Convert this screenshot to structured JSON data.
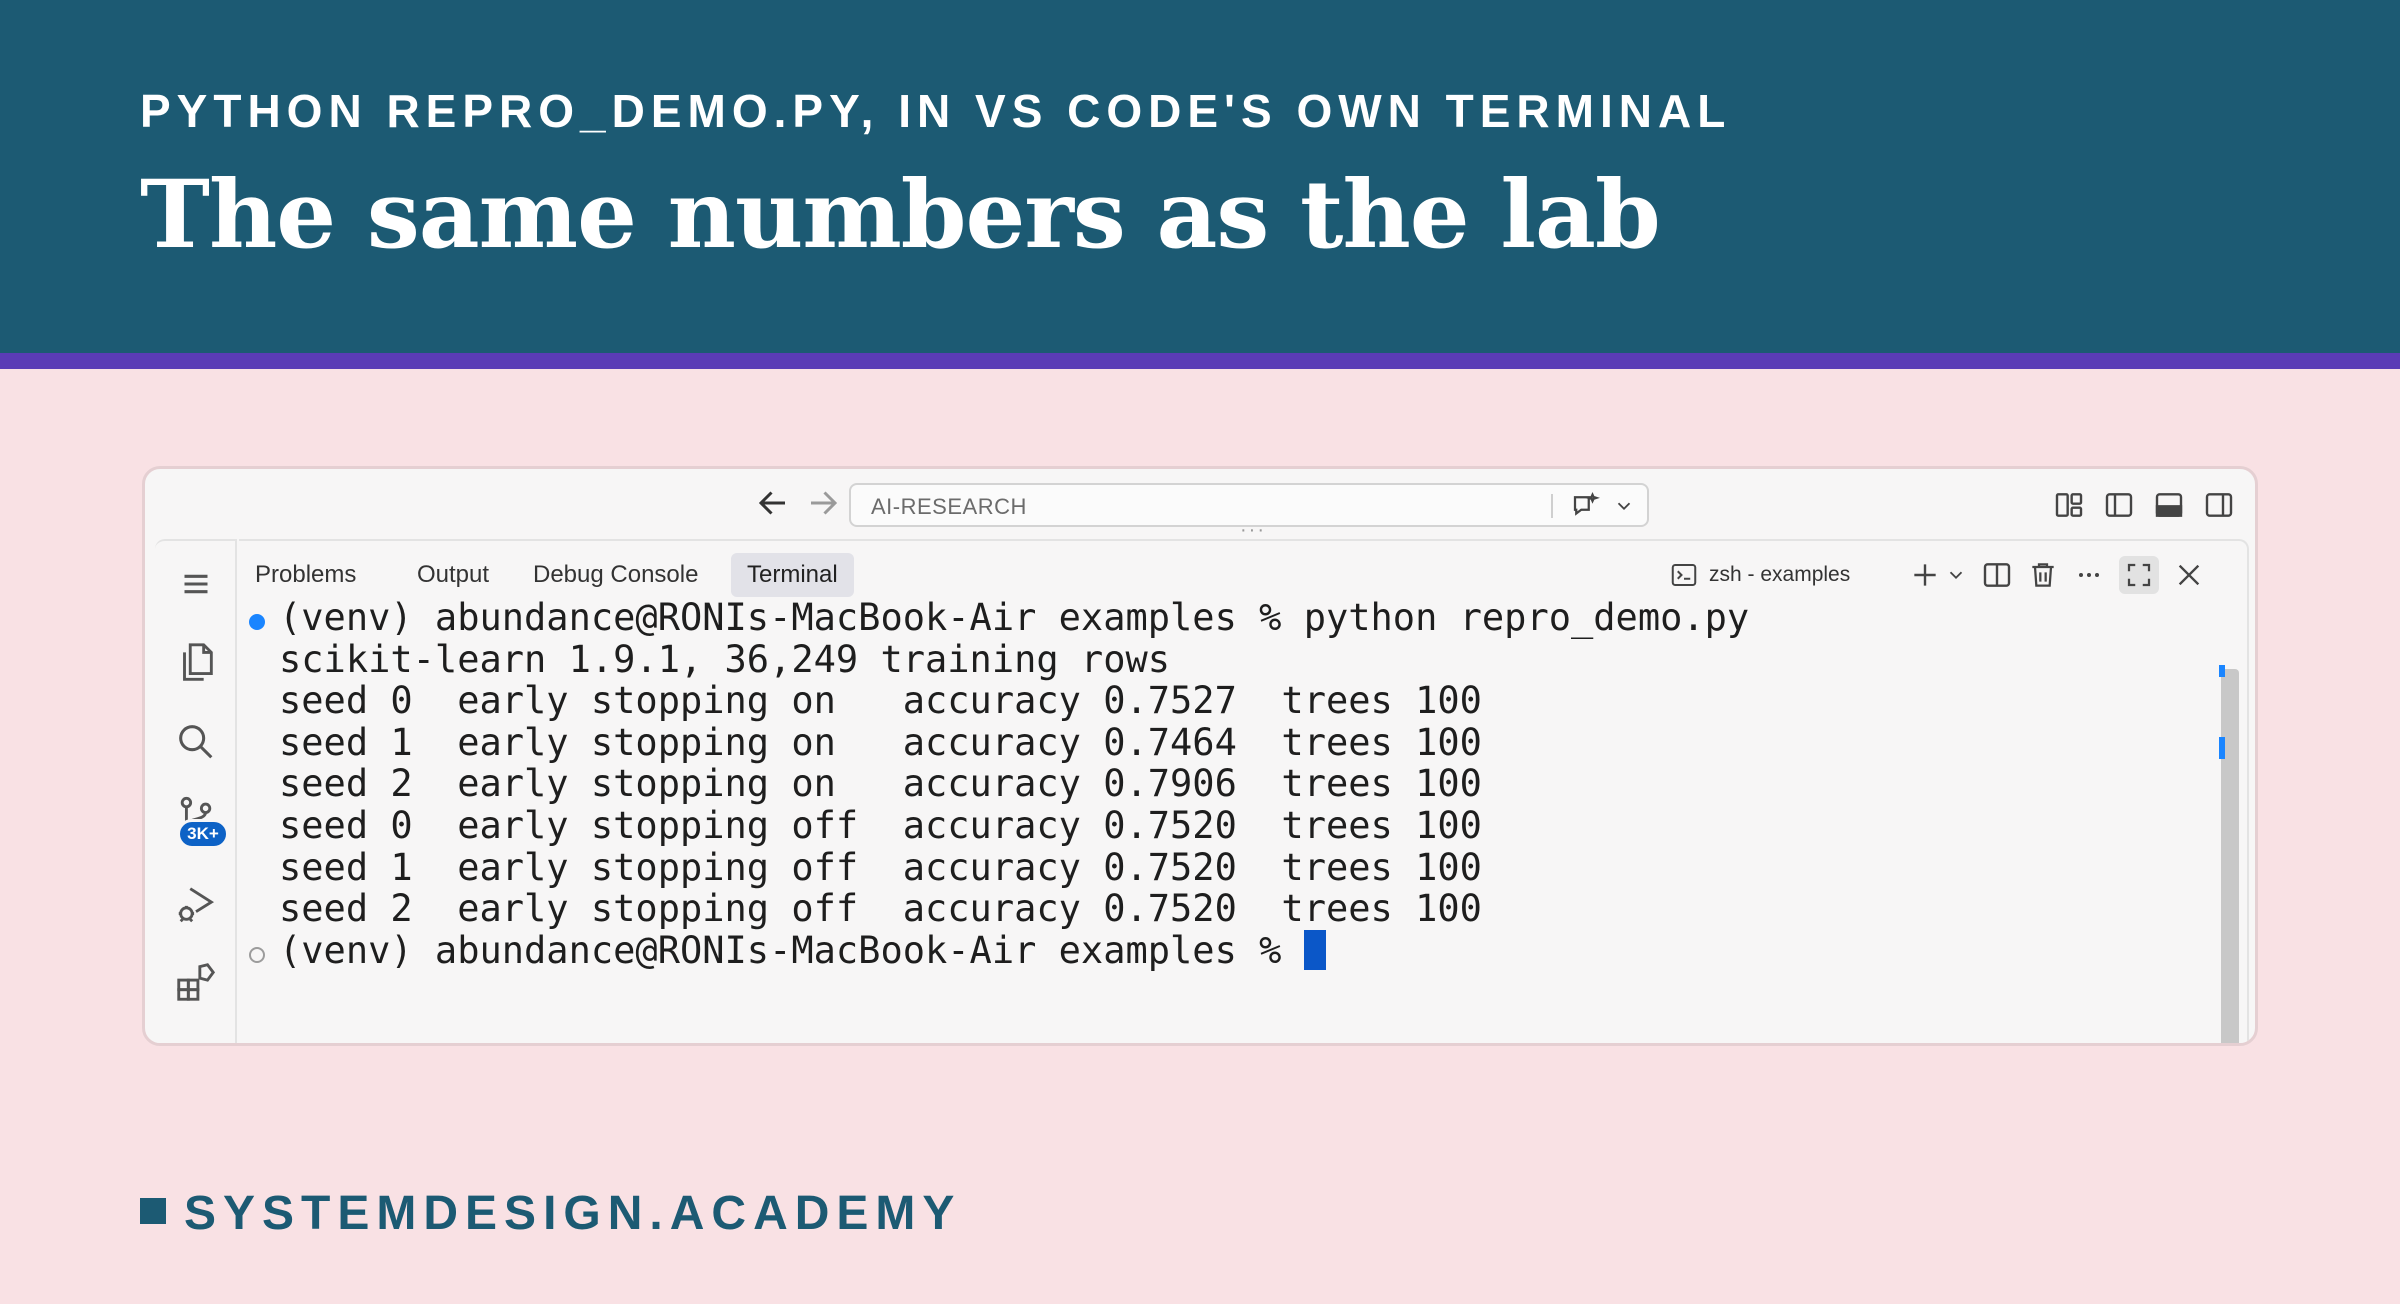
{
  "header": {
    "kicker": "PYTHON REPRO_DEMO.PY, IN VS CODE'S OWN TERMINAL",
    "title": "The same numbers as the lab"
  },
  "titlebar": {
    "command_center": "AI-RESEARCH",
    "icons": [
      "arrow-left-icon",
      "arrow-right-icon",
      "chat-sparkle-icon",
      "chevron-down-icon",
      "customize-layout-icon",
      "toggle-sidebar-icon",
      "toggle-panel-icon",
      "toggle-secondary-sidebar-icon"
    ]
  },
  "activity_bar": {
    "items": [
      "menu-icon",
      "explorer-icon",
      "search-icon",
      "source-control-icon",
      "run-debug-icon",
      "extensions-icon"
    ],
    "source_control_badge": "3K+"
  },
  "panel": {
    "tabs": [
      {
        "label": "Problems",
        "active": false
      },
      {
        "label": "Output",
        "active": false
      },
      {
        "label": "Debug Console",
        "active": false
      },
      {
        "label": "Terminal",
        "active": true
      }
    ],
    "terminal_name": "zsh - examples",
    "icons": [
      "new-terminal-icon",
      "chevron-down-icon",
      "split-terminal-icon",
      "trash-icon",
      "more-icon",
      "maximize-panel-icon",
      "close-icon"
    ]
  },
  "terminal": {
    "lines": [
      "(venv) abundance@RONIs-MacBook-Air examples % python repro_demo.py",
      "scikit-learn 1.9.1, 36,249 training rows",
      "seed 0  early stopping on   accuracy 0.7527  trees 100",
      "seed 1  early stopping on   accuracy 0.7464  trees 100",
      "seed 2  early stopping on   accuracy 0.7906  trees 100",
      "seed 0  early stopping off  accuracy 0.7520  trees 100",
      "seed 1  early stopping off  accuracy 0.7520  trees 100",
      "seed 2  early stopping off  accuracy 0.7520  trees 100"
    ],
    "prompt": "(venv) abundance@RONIs-MacBook-Air examples % "
  },
  "footer": {
    "brand": "SYSTEMDESIGN.ACADEMY"
  },
  "colors": {
    "header_bg": "#1c5a73",
    "stripe": "#5b3cb6",
    "page_bg": "#f9e1e4",
    "accent_blue": "#0d62c6"
  }
}
